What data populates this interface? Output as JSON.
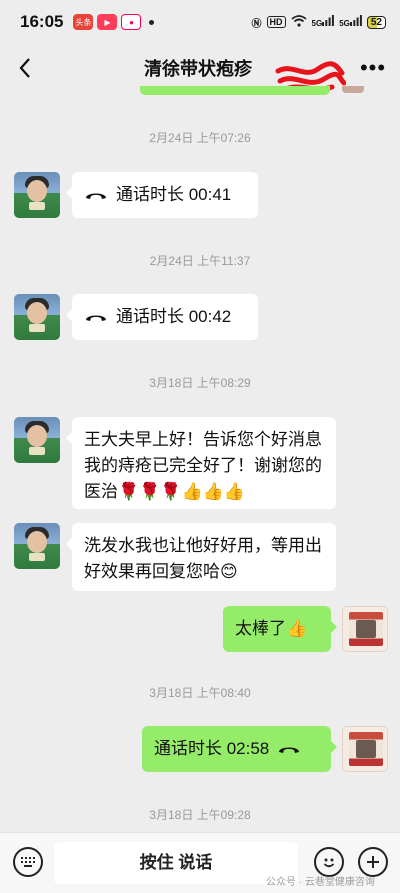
{
  "status_bar": {
    "time": "16:05",
    "app_badge": "头条",
    "hd_tag": "HD",
    "signal1": "5G",
    "signal2": "5G",
    "battery": "52"
  },
  "header": {
    "title": "清徐带状疱疹"
  },
  "messages": [
    {
      "type": "timestamp",
      "text": "2月24日 上午07:26"
    },
    {
      "type": "call",
      "side": "left",
      "text": "通话时长 00:41"
    },
    {
      "type": "timestamp",
      "text": "2月24日 上午11:37"
    },
    {
      "type": "call",
      "side": "left",
      "text": "通话时长 00:42"
    },
    {
      "type": "timestamp",
      "text": "3月18日 上午08:29"
    },
    {
      "type": "text",
      "side": "left",
      "text": "王大夫早上好！告诉您个好消息我的痔疮已完全好了！谢谢您的医治🌹🌹🌹👍👍👍"
    },
    {
      "type": "text",
      "side": "left",
      "text": "洗发水我也让他好好用，等用出好效果再回复您哈😊"
    },
    {
      "type": "text",
      "side": "right",
      "text": "太棒了👍"
    },
    {
      "type": "timestamp",
      "text": "3月18日 上午08:40"
    },
    {
      "type": "call",
      "side": "right",
      "text": "通话时长 02:58"
    },
    {
      "type": "timestamp",
      "text": "3月18日 上午09:28"
    }
  ],
  "input_bar": {
    "hold_to_talk": "按住 说话"
  },
  "watermark": "公众号 · 云巷堂健康咨询"
}
